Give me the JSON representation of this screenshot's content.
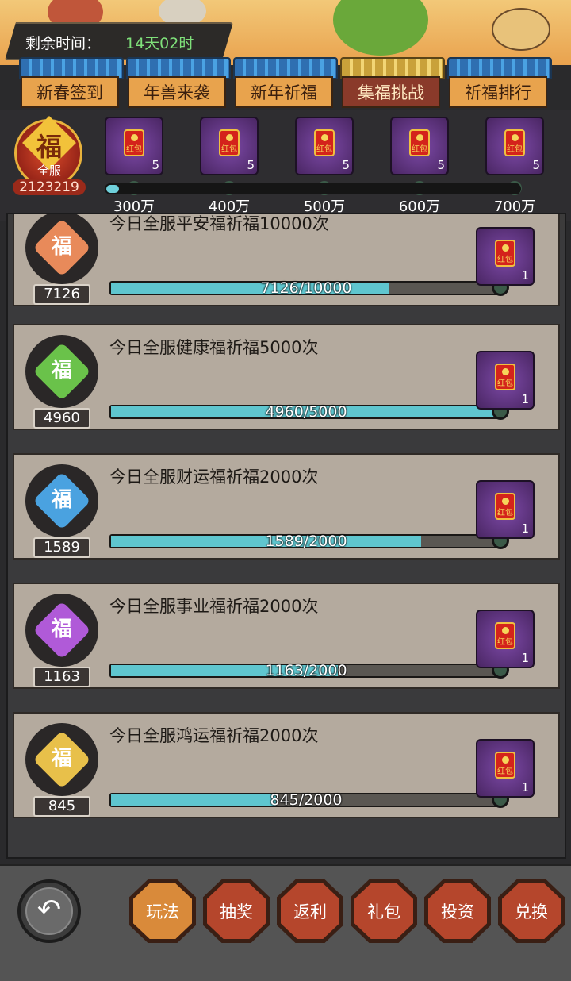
{
  "timer": {
    "label": "剩余时间：",
    "value": "14天02时"
  },
  "tabs": [
    {
      "label": "新春签到",
      "active": false
    },
    {
      "label": "年兽来袭",
      "active": false
    },
    {
      "label": "新年祈福",
      "active": false
    },
    {
      "label": "集福挑战",
      "active": true
    },
    {
      "label": "祈福排行",
      "active": false
    }
  ],
  "server_fu": {
    "glyph": "福",
    "label": "全服",
    "count": "2123219"
  },
  "redpacket_text": "红包",
  "milestones": {
    "progress": 0.03,
    "items": [
      {
        "label": "300万",
        "qty": "5"
      },
      {
        "label": "400万",
        "qty": "5"
      },
      {
        "label": "500万",
        "qty": "5"
      },
      {
        "label": "600万",
        "qty": "5"
      },
      {
        "label": "700万",
        "qty": "5"
      }
    ]
  },
  "tasks": [
    {
      "title": "今日全服平安福祈福10000次",
      "count": "7126",
      "progress_text": "7126/10000",
      "fraction": 0.7126,
      "reward_qty": "1",
      "color": "#e88a5a",
      "glyph": "福"
    },
    {
      "title": "今日全服健康福祈福5000次",
      "count": "4960",
      "progress_text": "4960/5000",
      "fraction": 0.992,
      "reward_qty": "1",
      "color": "#6ac24a",
      "glyph": "福"
    },
    {
      "title": "今日全服财运福祈福2000次",
      "count": "1589",
      "progress_text": "1589/2000",
      "fraction": 0.7945,
      "reward_qty": "1",
      "color": "#4aa2e0",
      "glyph": "福"
    },
    {
      "title": "今日全服事业福祈福2000次",
      "count": "1163",
      "progress_text": "1163/2000",
      "fraction": 0.5815,
      "reward_qty": "1",
      "color": "#b05ad8",
      "glyph": "福"
    },
    {
      "title": "今日全服鸿运福祈福2000次",
      "count": "845",
      "progress_text": "845/2000",
      "fraction": 0.4225,
      "reward_qty": "1",
      "color": "#e8c04a",
      "glyph": "福"
    }
  ],
  "footer": {
    "back_icon": "↶",
    "buttons": [
      {
        "label": "玩法",
        "active": true
      },
      {
        "label": "抽奖",
        "active": false
      },
      {
        "label": "返利",
        "active": false
      },
      {
        "label": "礼包",
        "active": false
      },
      {
        "label": "投资",
        "active": false
      },
      {
        "label": "兑换",
        "active": false
      }
    ]
  }
}
